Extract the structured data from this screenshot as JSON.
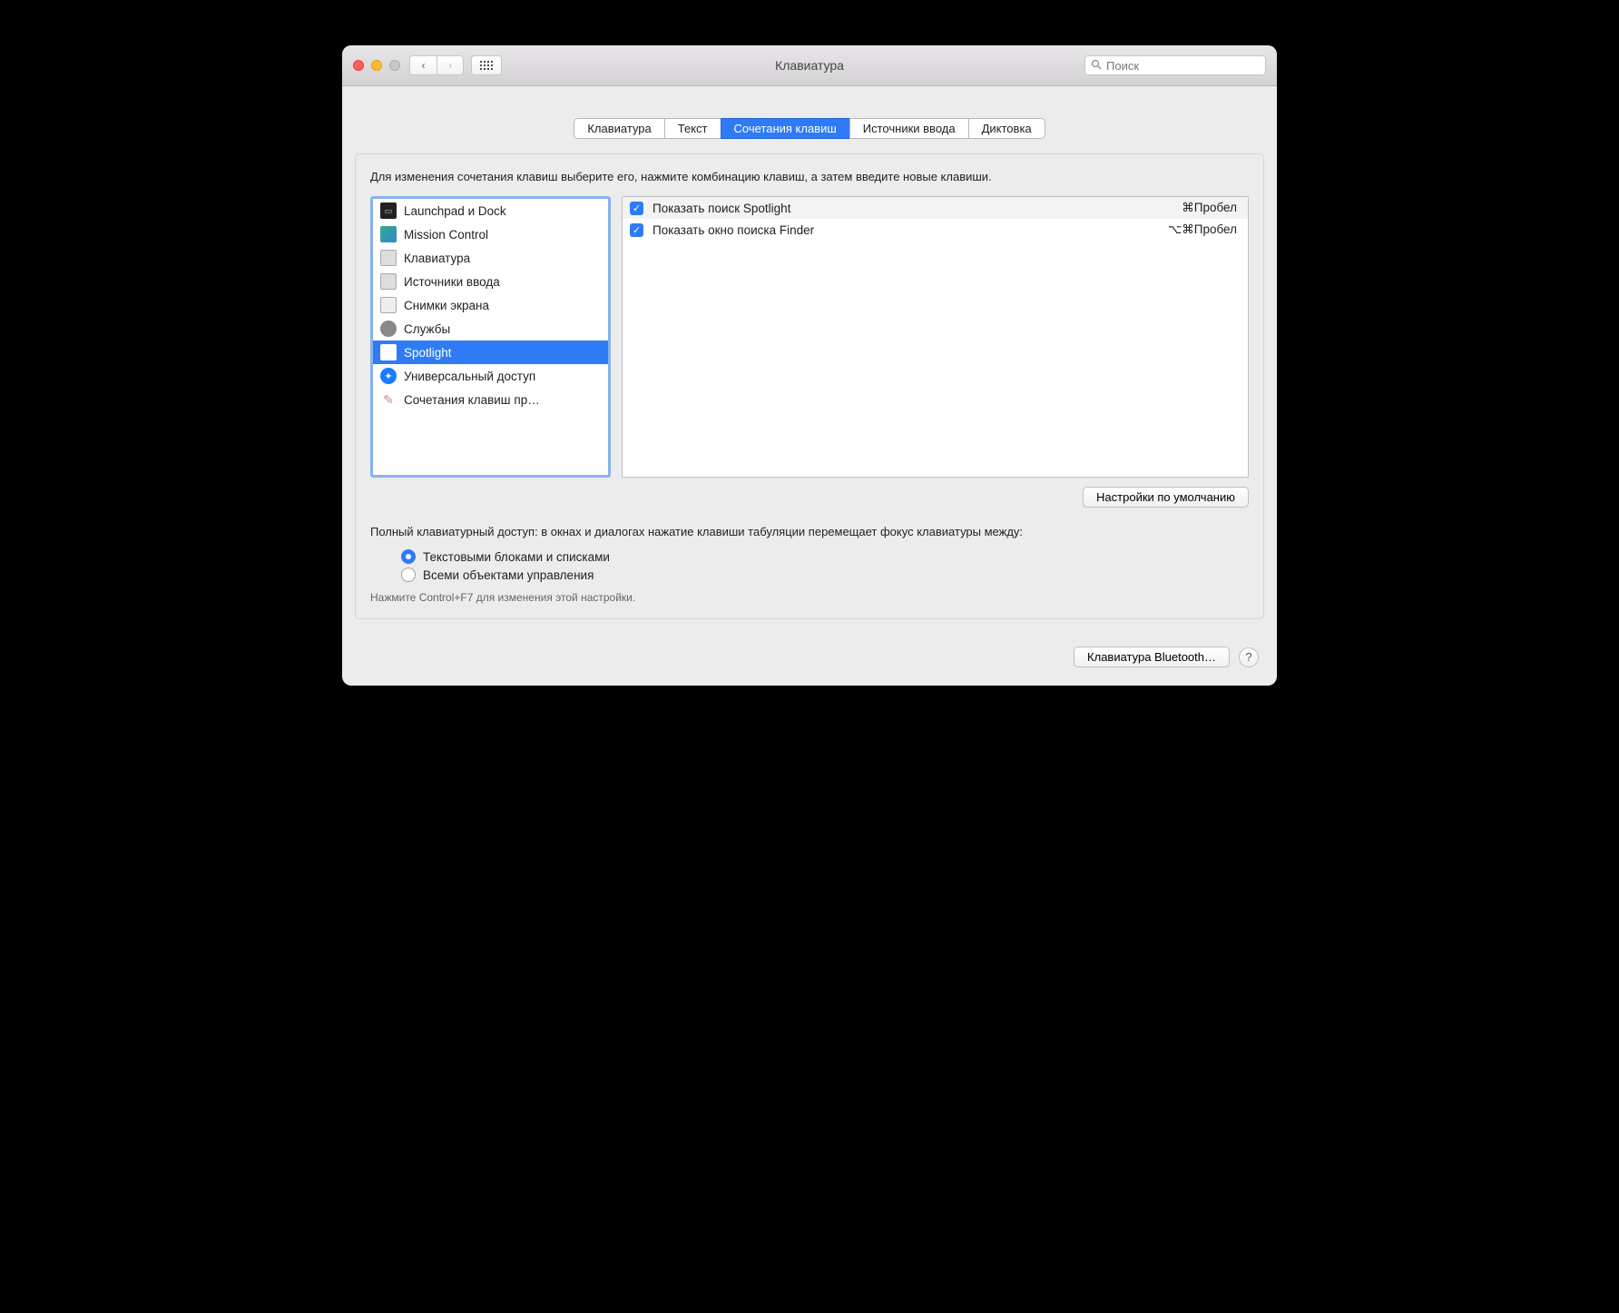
{
  "window": {
    "title": "Клавиатура"
  },
  "search": {
    "placeholder": "Поиск"
  },
  "tabs": [
    {
      "label": "Клавиатура"
    },
    {
      "label": "Текст"
    },
    {
      "label": "Сочетания клавиш",
      "active": true
    },
    {
      "label": "Источники ввода"
    },
    {
      "label": "Диктовка"
    }
  ],
  "instruction": "Для изменения сочетания клавиш выберите его, нажмите комбинацию клавиш, а затем введите новые клавиши.",
  "categories": [
    {
      "label": "Launchpad и Dock",
      "icon": "launchpad"
    },
    {
      "label": "Mission Control",
      "icon": "mission"
    },
    {
      "label": "Клавиатура",
      "icon": "keyboard"
    },
    {
      "label": "Источники ввода",
      "icon": "input"
    },
    {
      "label": "Снимки экрана",
      "icon": "screenshot"
    },
    {
      "label": "Службы",
      "icon": "services"
    },
    {
      "label": "Spotlight",
      "icon": "spotlight",
      "selected": true
    },
    {
      "label": "Универсальный доступ",
      "icon": "accessibility"
    },
    {
      "label": "Сочетания клавиш пр…",
      "icon": "app"
    }
  ],
  "shortcuts": [
    {
      "checked": true,
      "label": "Показать поиск Spotlight",
      "key": "⌘Пробел"
    },
    {
      "checked": true,
      "label": "Показать окно поиска Finder",
      "key": "⌥⌘Пробел"
    }
  ],
  "defaults_button": "Настройки по умолчанию",
  "access": {
    "text": "Полный клавиатурный доступ: в окнах и диалогах нажатие клавиши табуляции перемещает фокус клавиатуры между:",
    "options": [
      {
        "label": "Текстовыми блоками и списками",
        "checked": true
      },
      {
        "label": "Всеми объектами управления",
        "checked": false
      }
    ],
    "hint": "Нажмите Control+F7 для изменения этой настройки."
  },
  "footer": {
    "bluetooth_button": "Клавиатура Bluetooth…",
    "help": "?"
  }
}
